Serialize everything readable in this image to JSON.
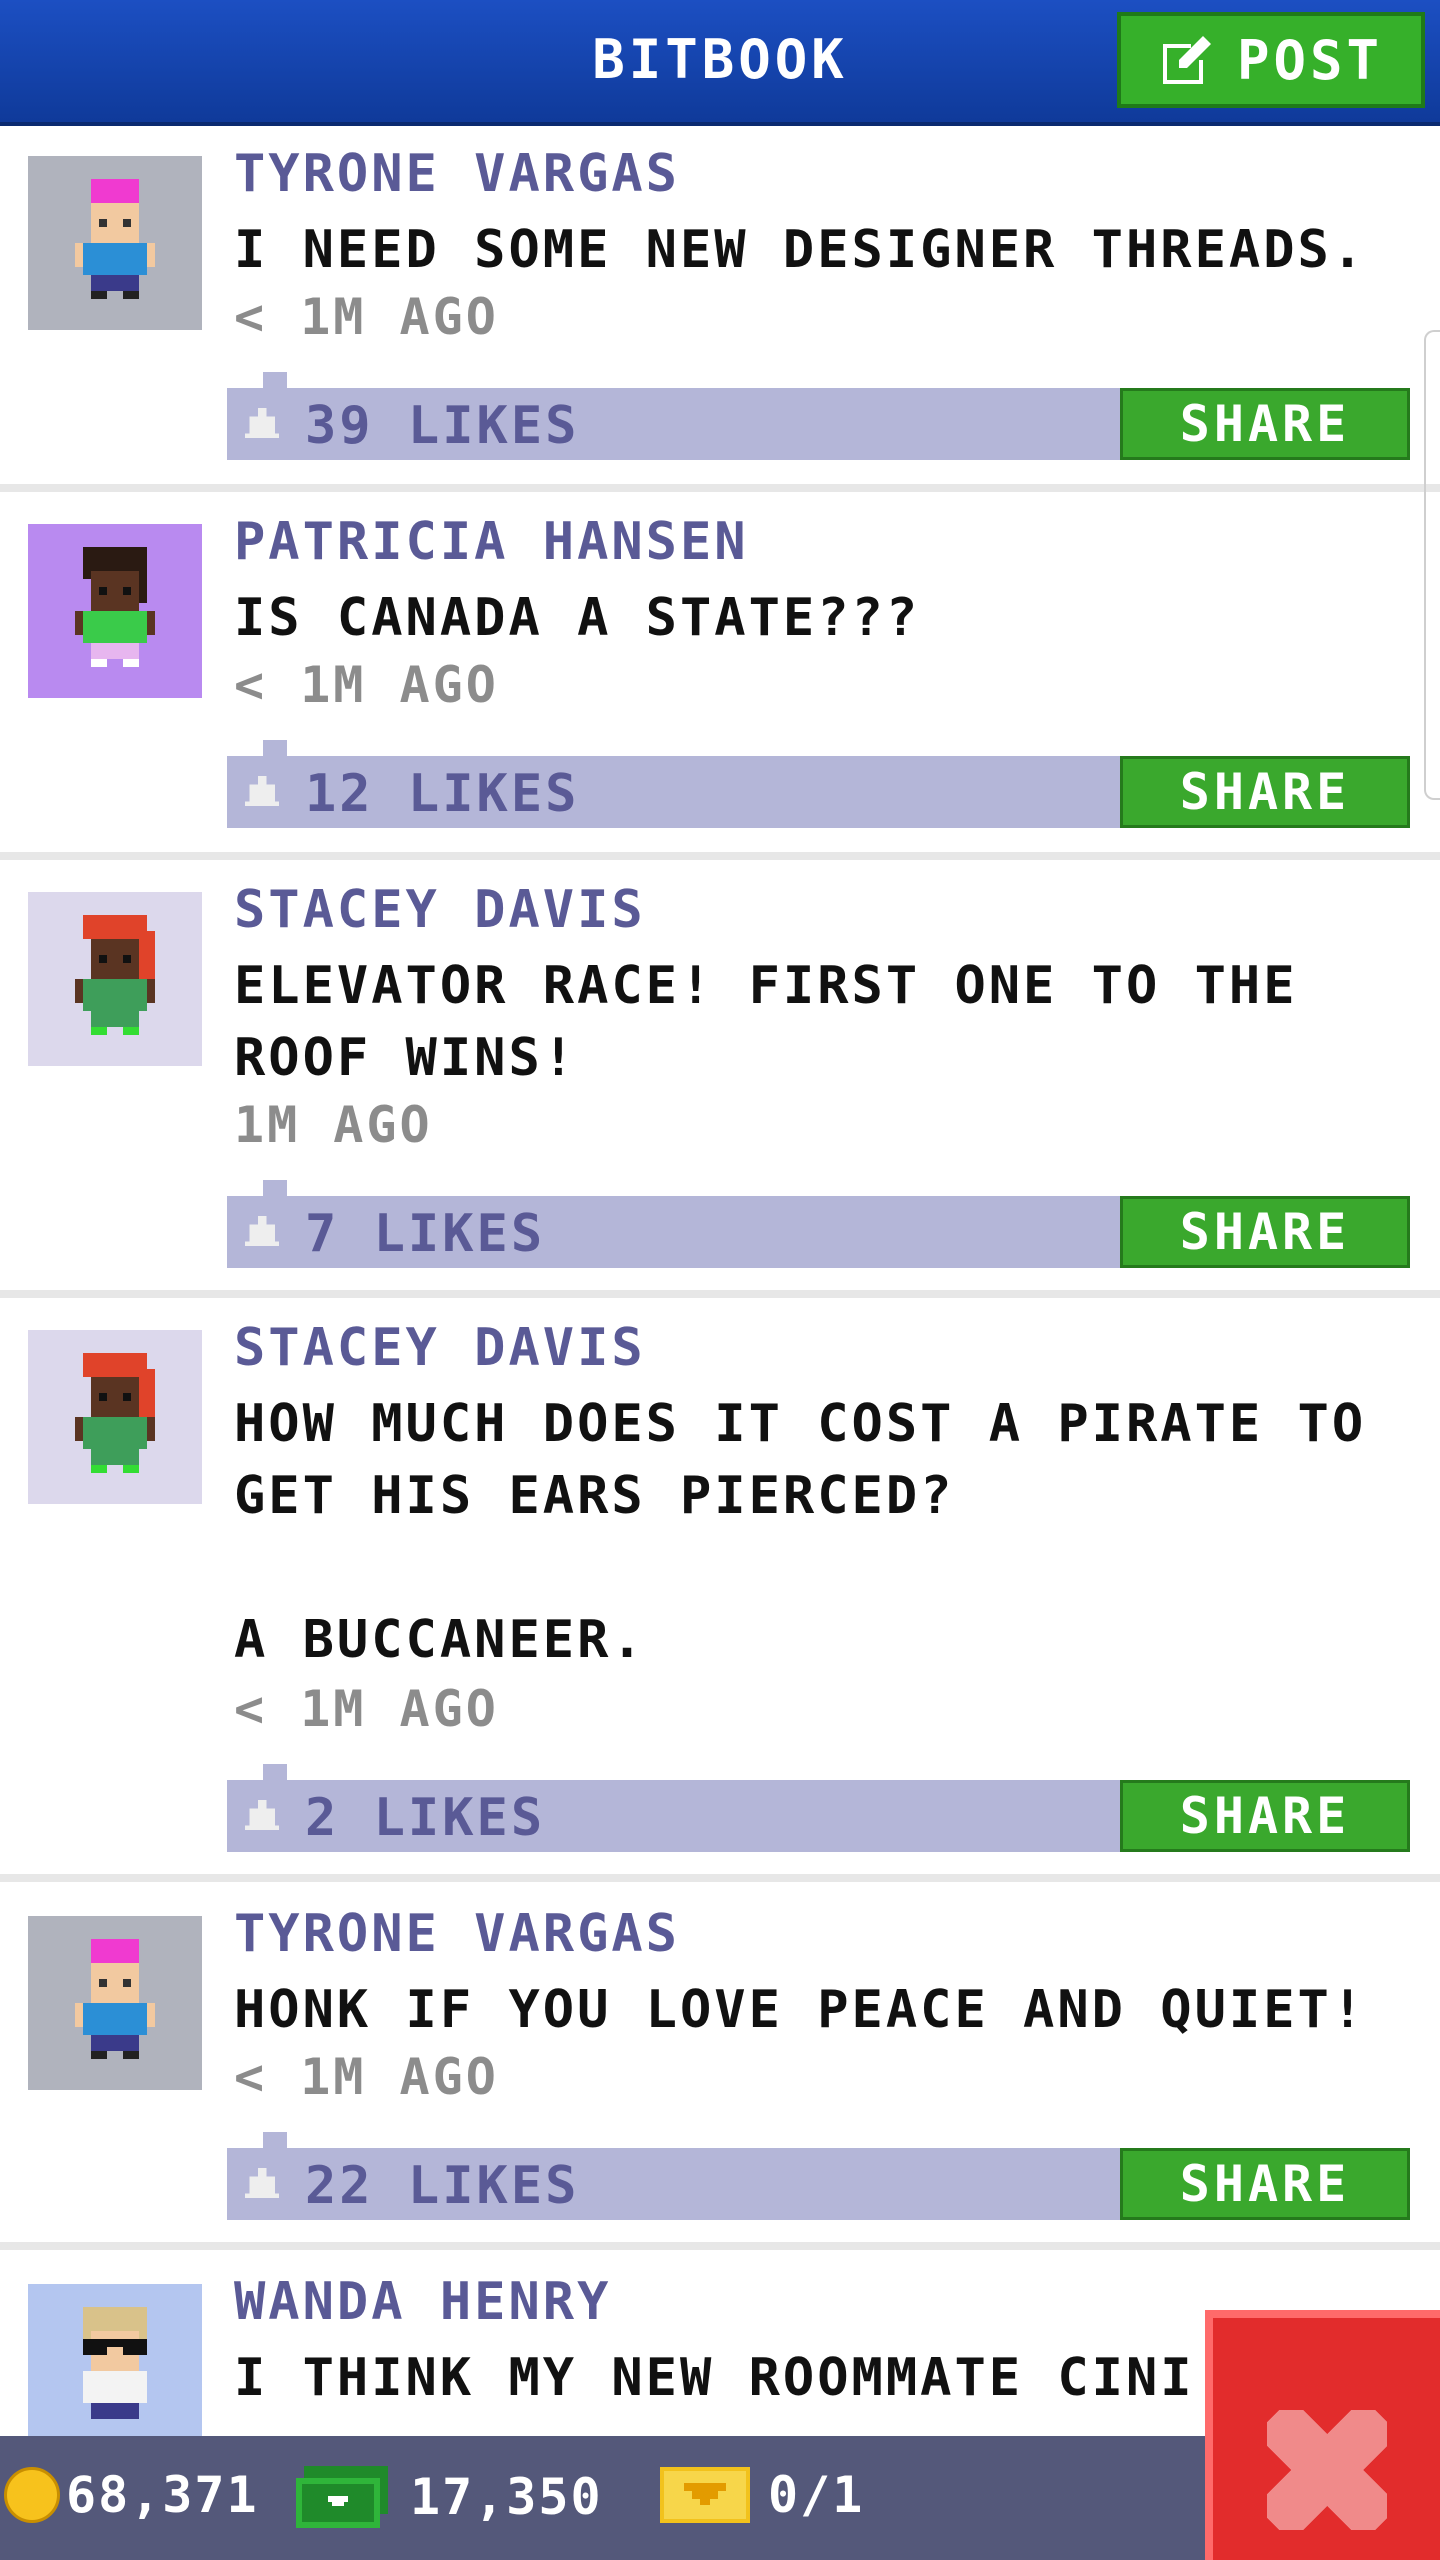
{
  "header": {
    "title": "BITBOOK",
    "post_label": "POST"
  },
  "posts": [
    {
      "author": "TYRONE VARGAS",
      "message": "I NEED SOME NEW DESIGNER THREADS.",
      "time": "< 1M AGO",
      "likes": "39 LIKES",
      "share": "SHARE",
      "avatar_bg": "#b0b3bd"
    },
    {
      "author": "PATRICIA HANSEN",
      "message": "IS CANADA A STATE???",
      "time": "< 1M AGO",
      "likes": "12 LIKES",
      "share": "SHARE",
      "avatar_bg": "#b98af0"
    },
    {
      "author": "STACEY DAVIS",
      "message": "ELEVATOR RACE! FIRST ONE TO THE\nROOF WINS!",
      "time": "1M AGO",
      "likes": "7 LIKES",
      "share": "SHARE",
      "avatar_bg": "#dcd8ec"
    },
    {
      "author": "STACEY DAVIS",
      "message": "HOW MUCH DOES IT COST A PIRATE TO\nGET HIS EARS PIERCED?\n\nA BUCCANEER.",
      "time": "< 1M AGO",
      "likes": "2 LIKES",
      "share": "SHARE",
      "avatar_bg": "#dcd8ec"
    },
    {
      "author": "TYRONE VARGAS",
      "message": "HONK IF YOU LOVE PEACE AND QUIET!",
      "time": "< 1M AGO",
      "likes": "22 LIKES",
      "share": "SHARE",
      "avatar_bg": "#b0b3bd"
    },
    {
      "author": "WANDA HENRY",
      "message": "I THINK MY NEW ROOMMATE CINI",
      "avatar_bg": "#b4c6f0"
    }
  ],
  "currency": {
    "coins": "68,371",
    "bux": "17,350",
    "tickets": "0/1"
  },
  "colors": {
    "header": "#1c4fc2",
    "accent_green": "#36b02a",
    "close_red": "#e22c2c",
    "likes_bar": "#b4b6d8"
  }
}
